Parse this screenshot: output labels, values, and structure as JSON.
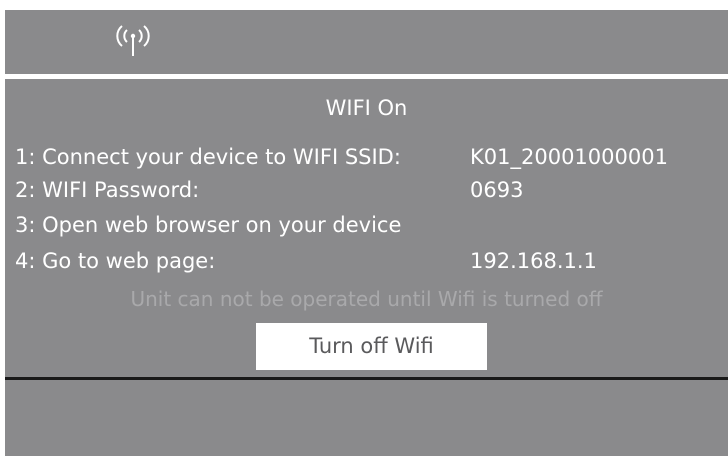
{
  "status_bar": {
    "wifi_icon": "wifi-broadcast-icon"
  },
  "panel": {
    "title": "WIFI On",
    "rows": [
      {
        "label": "1: Connect your device to WIFI SSID:",
        "value": "K01_20001000001"
      },
      {
        "label": "2: WIFI Password:",
        "value": "0693"
      },
      {
        "label": "3: Open web browser on your device",
        "value": ""
      },
      {
        "label": "4: Go to web page:",
        "value": "192.168.1.1"
      }
    ],
    "notice": "Unit can not be operated until Wifi is turned off",
    "button_label": "Turn off Wifi"
  },
  "colors": {
    "panel_background": "#8a8a8c",
    "text": "#ffffff",
    "notice_text": "#a9a9ab",
    "button_background": "#ffffff",
    "button_text": "#5a5a5c",
    "divider": "#1a1a1a"
  }
}
